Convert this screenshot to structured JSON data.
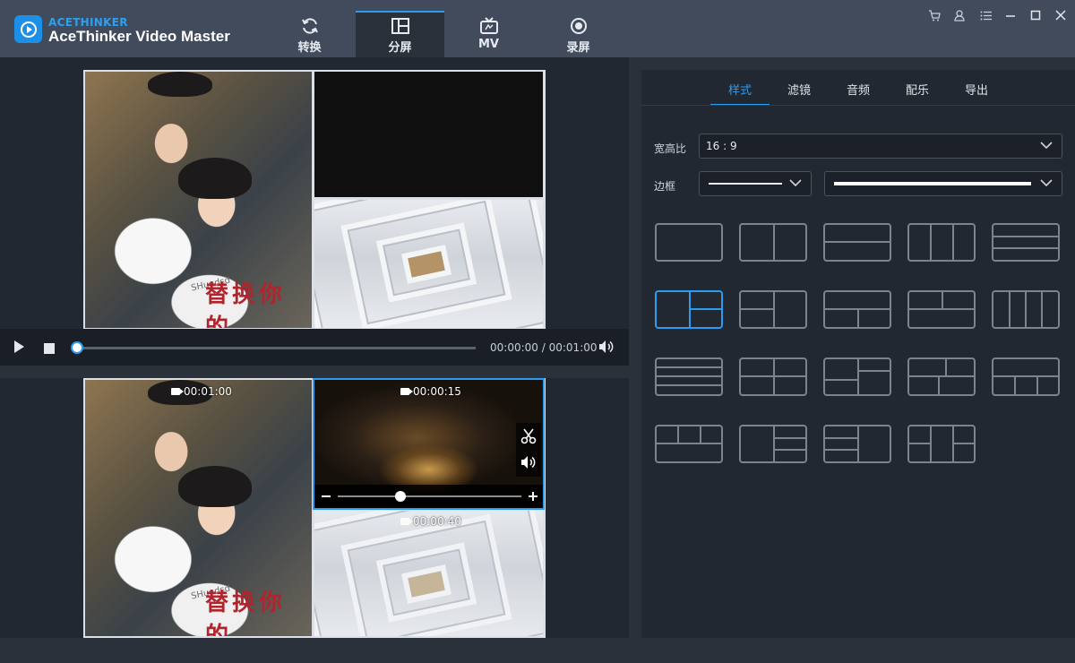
{
  "app": {
    "brand_small": "ACETHINKER",
    "brand_main": "AceThinker Video Master"
  },
  "nav_tabs": [
    {
      "label": "转换",
      "icon": "convert-icon"
    },
    {
      "label": "分屏",
      "icon": "split-screen-icon",
      "active": true
    },
    {
      "label": "MV",
      "icon": "mv-tv-icon"
    },
    {
      "label": "录屏",
      "icon": "record-icon"
    }
  ],
  "window_controls": [
    "cart-icon",
    "user-icon",
    "menu-icon",
    "minimize-icon",
    "maximize-icon",
    "close-icon"
  ],
  "preview": {
    "photo_caption": "替换你的",
    "photo_tag": "SHundsd",
    "current_time": "00:00:00",
    "separator": "/",
    "total_time": "00:01:00",
    "progress": 0
  },
  "editor": {
    "clips": [
      {
        "duration": "00:01:00"
      },
      {
        "duration": "00:00:15"
      },
      {
        "duration": "00:00:40"
      }
    ],
    "volume_level": 0.34
  },
  "right_tabs": [
    {
      "label": "样式",
      "active": true
    },
    {
      "label": "滤镜"
    },
    {
      "label": "音频"
    },
    {
      "label": "配乐"
    },
    {
      "label": "导出"
    }
  ],
  "settings": {
    "aspect_label": "宽高比",
    "aspect_value": "16 : 9",
    "border_label": "边框"
  },
  "colors": {
    "accent": "#2b9df0",
    "panel": "#222831",
    "topbar": "#414b5b"
  },
  "layouts_selected_index": 5,
  "layout_count": 19
}
